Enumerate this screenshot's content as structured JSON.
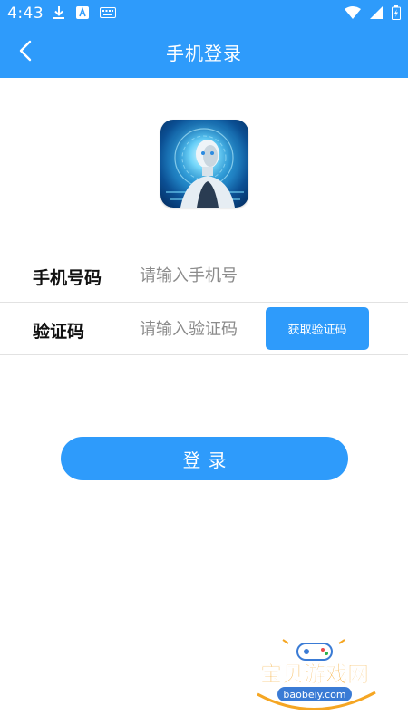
{
  "status_bar": {
    "time": "4:43",
    "left_icons": [
      "download-icon",
      "a-app-icon",
      "keyboard-icon"
    ],
    "right_icons": [
      "wifi-icon",
      "signal-icon",
      "battery-charging-icon"
    ]
  },
  "header": {
    "title": "手机登录",
    "back_icon": "chevron-left-icon"
  },
  "app_icon": {
    "name": "robot-app-icon"
  },
  "form": {
    "phone": {
      "label": "手机号码",
      "placeholder": "请输入手机号",
      "value": ""
    },
    "code": {
      "label": "验证码",
      "placeholder": "请输入验证码",
      "value": "",
      "get_code_label": "获取验证码"
    }
  },
  "login_button": {
    "label": "登录"
  },
  "watermark": {
    "text": "宝贝游戏网",
    "url": "baobeiy.com"
  },
  "colors": {
    "primary": "#2e9bfb",
    "text": "#111111",
    "placeholder": "#8b8b8b",
    "divider": "#e2e2e2"
  }
}
